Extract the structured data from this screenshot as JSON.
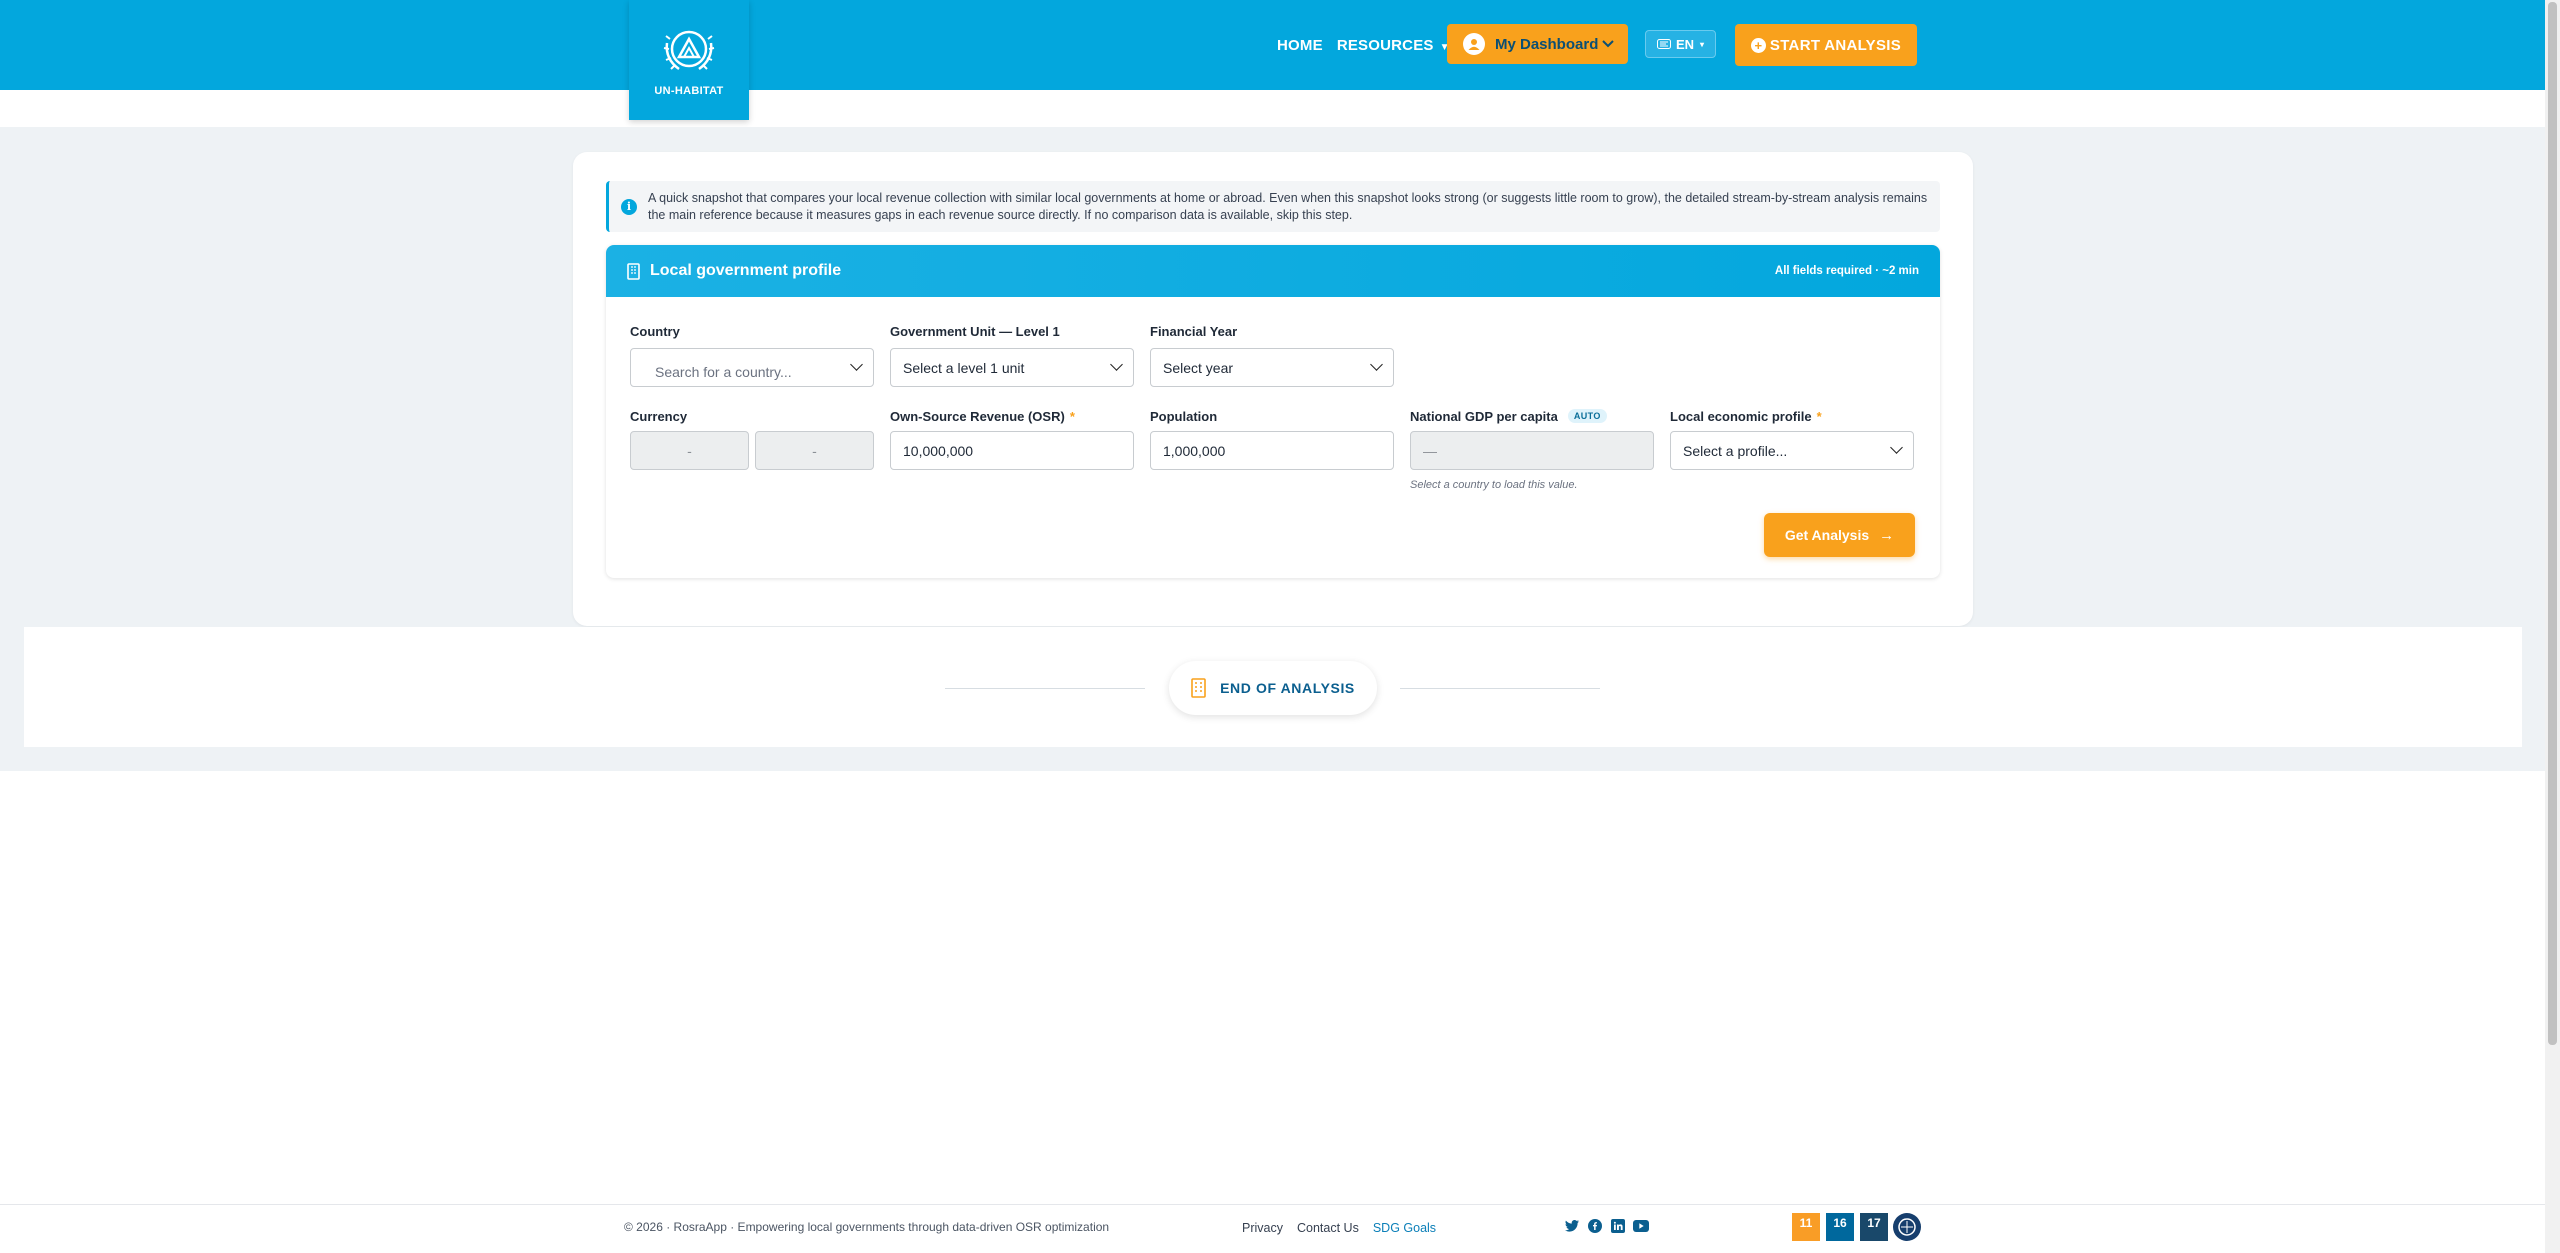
{
  "header": {
    "logo_text": "UN-HABITAT",
    "nav": [
      {
        "label": "HOME"
      },
      {
        "label": "RESOURCES"
      }
    ],
    "dashboard_label": "My Dashboard",
    "language": "EN",
    "start_label": "START ANALYSIS"
  },
  "info": {
    "text": "A quick snapshot that compares your local revenue collection with similar local governments at home or abroad. Even when this snapshot looks strong (or suggests little room to grow), the detailed stream-by-stream analysis remains the main reference because it measures gaps in each revenue source directly. If no comparison data is available, skip this step."
  },
  "profile": {
    "title": "Local government profile",
    "meta": "All fields required · ~2 min",
    "country": {
      "label": "Country",
      "placeholder": "Search for a country..."
    },
    "level1": {
      "label": "Government Unit — Level 1",
      "value": "Select a level 1 unit"
    },
    "year": {
      "label": "Financial Year",
      "value": "Select year"
    },
    "currency": {
      "label": "Currency",
      "value_a": "-",
      "value_b": "-"
    },
    "osr": {
      "label": "Own-Source Revenue (OSR)",
      "required": "*",
      "value": "10,000,000"
    },
    "population": {
      "label": "Population",
      "value": "1,000,000"
    },
    "gdp": {
      "label": "National GDP per capita",
      "badge": "AUTO",
      "value": "—",
      "hint": "Select a country to load this value."
    },
    "econ": {
      "label": "Local economic profile",
      "required": "*",
      "value": "Select a profile..."
    },
    "submit_label": "Get Analysis",
    "submit_arrow": "→"
  },
  "end": {
    "label": "END OF ANALYSIS"
  },
  "footer": {
    "copyright": "© 2026 · RosraApp · Empowering local governments through data-driven OSR optimization",
    "links": [
      "Privacy",
      "Contact Us",
      "SDG Goals"
    ],
    "sdg": [
      {
        "number": "11",
        "color": "#f99d26"
      },
      {
        "number": "16",
        "color": "#00689d"
      },
      {
        "number": "17",
        "color": "#19486a"
      }
    ]
  },
  "colors": {
    "brand": "#03a7dd",
    "accent": "#f9a11c",
    "navy": "#0b5f8f"
  }
}
